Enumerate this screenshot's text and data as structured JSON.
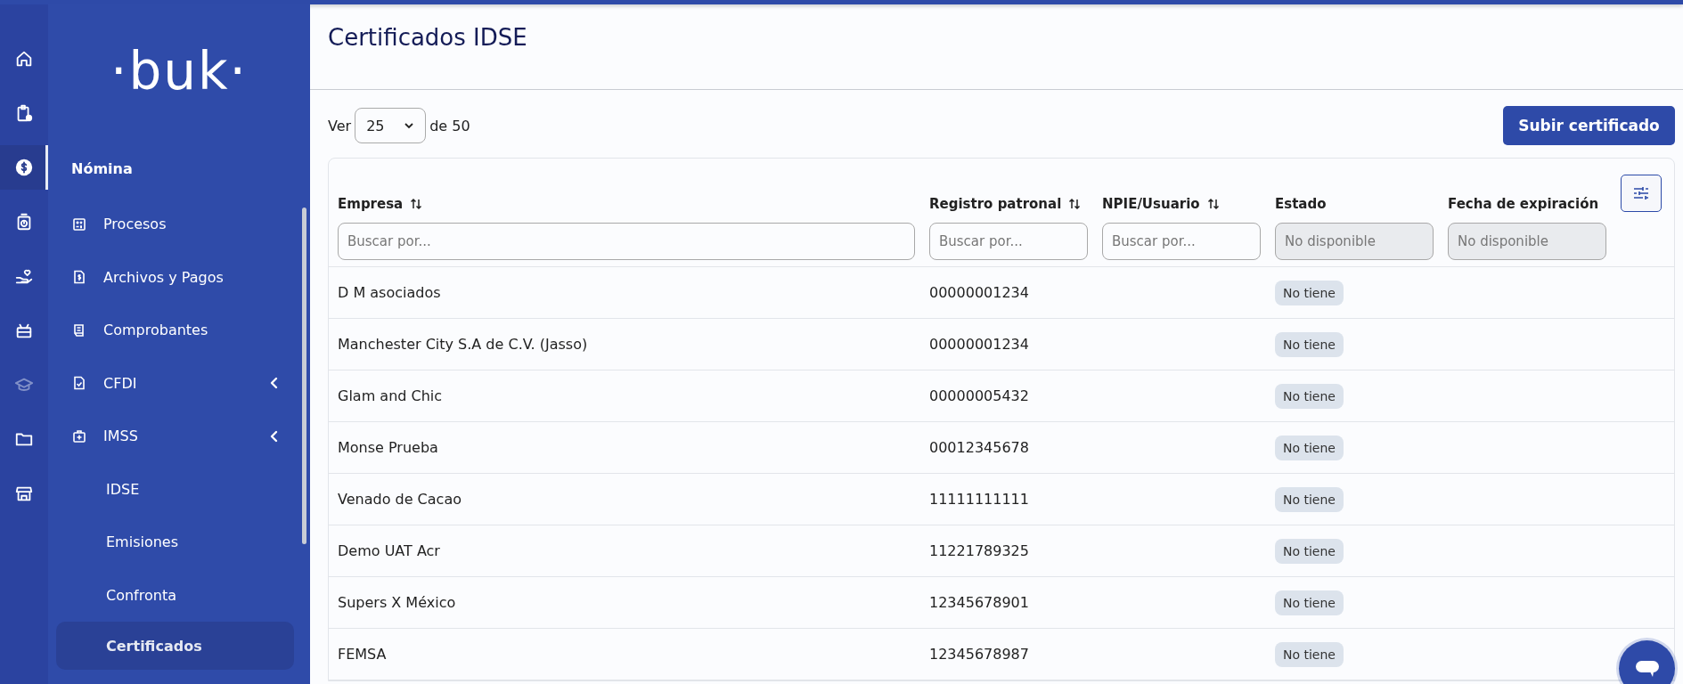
{
  "rail": {
    "items": [
      {
        "selected": false,
        "disabled": false
      },
      {
        "selected": false,
        "disabled": false
      },
      {
        "selected": true,
        "disabled": false
      },
      {
        "selected": false,
        "disabled": false
      },
      {
        "selected": false,
        "disabled": false
      },
      {
        "selected": false,
        "disabled": false
      },
      {
        "selected": false,
        "disabled": true
      },
      {
        "selected": false,
        "disabled": false
      },
      {
        "selected": false,
        "disabled": false
      }
    ]
  },
  "sidebar": {
    "logo": "·buk·",
    "section": "Nómina",
    "items": [
      {
        "label": "Procesos",
        "kind": "link"
      },
      {
        "label": "Archivos y Pagos",
        "kind": "link"
      },
      {
        "label": "Comprobantes",
        "kind": "link"
      },
      {
        "label": "CFDI",
        "kind": "group"
      },
      {
        "label": "IMSS",
        "kind": "group",
        "children": [
          {
            "label": "IDSE",
            "selected": false
          },
          {
            "label": "Emisiones",
            "selected": false
          },
          {
            "label": "Confronta",
            "selected": false
          },
          {
            "label": "Certificados",
            "selected": true
          }
        ]
      }
    ]
  },
  "page": {
    "title": "Certificados IDSE"
  },
  "pager": {
    "before": "Ver",
    "value": "25",
    "after": "de 50"
  },
  "upload_button": "Subir certificado",
  "table": {
    "columns": [
      {
        "label": "Empresa",
        "sortable": true,
        "filter": {
          "placeholder": "Buscar por...",
          "disabled": false
        }
      },
      {
        "label": "Registro patronal",
        "sortable": true,
        "filter": {
          "placeholder": "Buscar por...",
          "disabled": false
        }
      },
      {
        "label": "NPIE/Usuario",
        "sortable": true,
        "filter": {
          "placeholder": "Buscar por...",
          "disabled": false
        }
      },
      {
        "label": "Estado",
        "sortable": false,
        "filter": {
          "placeholder": "No disponible",
          "disabled": true
        }
      },
      {
        "label": "Fecha de expiración",
        "sortable": false,
        "filter": {
          "placeholder": "No disponible",
          "disabled": true
        }
      }
    ],
    "rows": [
      {
        "empresa": "D M asociados",
        "registro": "00000001234",
        "estado": "No tiene"
      },
      {
        "empresa": "Manchester City S.A de C.V. (Jasso)",
        "registro": "00000001234",
        "estado": "No tiene"
      },
      {
        "empresa": "Glam and Chic",
        "registro": "00000005432",
        "estado": "No tiene"
      },
      {
        "empresa": "Monse Prueba",
        "registro": "00012345678",
        "estado": "No tiene"
      },
      {
        "empresa": "Venado de Cacao",
        "registro": "11111111111",
        "estado": "No tiene"
      },
      {
        "empresa": "Demo UAT Acr",
        "registro": "11221789325",
        "estado": "No tiene"
      },
      {
        "empresa": "Supers X México",
        "registro": "12345678901",
        "estado": "No tiene"
      },
      {
        "empresa": "FEMSA",
        "registro": "12345678987",
        "estado": "No tiene"
      }
    ]
  }
}
